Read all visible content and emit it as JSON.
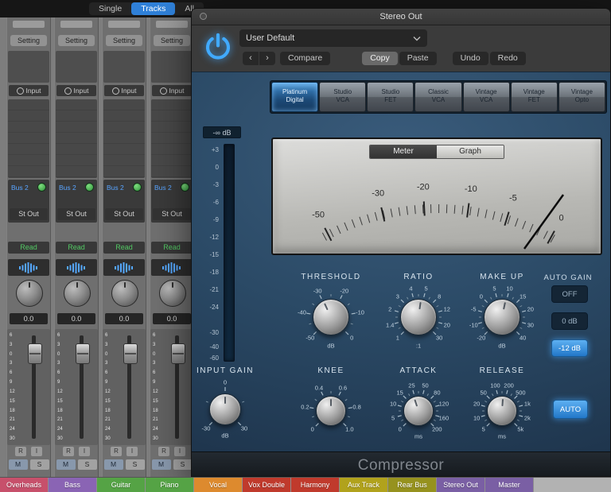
{
  "top_bar": {
    "tabs": [
      {
        "label": "Single",
        "selected": false
      },
      {
        "label": "Tracks",
        "selected": true
      },
      {
        "label": "All",
        "selected": false
      }
    ]
  },
  "mixer": {
    "strip_count": 4,
    "channel_strip": {
      "setting": "Setting",
      "input": "Input",
      "send": "Bus 2",
      "output": "St Out",
      "automation": "Read",
      "volume": "0.0",
      "record": "R",
      "input_monitor": "I",
      "mute": "M",
      "solo": "S",
      "fader_scale": [
        "6",
        "3",
        "0",
        "3",
        "6",
        "9",
        "12",
        "15",
        "18",
        "21",
        "24",
        "30"
      ]
    },
    "track_labels": [
      {
        "name": "Overheads",
        "color": "#c7506b"
      },
      {
        "name": "Bass",
        "color": "#8a64b4"
      },
      {
        "name": "Guitar",
        "color": "#55a345"
      },
      {
        "name": "Piano",
        "color": "#55a345"
      },
      {
        "name": "Vocal",
        "color": "#dd8a2e"
      },
      {
        "name": "Vox Double",
        "color": "#c03a2c"
      },
      {
        "name": "Harmony",
        "color": "#c03a2c"
      },
      {
        "name": "Aux Track",
        "color": "#b1a21c"
      },
      {
        "name": "Rear Bus",
        "color": "#96921e"
      },
      {
        "name": "Stereo Out",
        "color": "#7a5fa4"
      },
      {
        "name": "Master",
        "color": "#7a5fa4"
      }
    ]
  },
  "plugin": {
    "window_title": "Stereo Out",
    "preset_name": "User Default",
    "nav_back": "‹",
    "nav_forward": "›",
    "header_buttons": [
      {
        "label": "Compare",
        "active": false
      },
      {
        "label": "Copy",
        "active": true
      },
      {
        "label": "Paste",
        "active": false
      },
      {
        "label": "Undo",
        "active": false
      },
      {
        "label": "Redo",
        "active": false
      }
    ],
    "circuit_types": [
      {
        "line1": "Platinum",
        "line2": "Digital",
        "selected": true
      },
      {
        "line1": "Studio",
        "line2": "VCA",
        "selected": false
      },
      {
        "line1": "Studio",
        "line2": "FET",
        "selected": false
      },
      {
        "line1": "Classic",
        "line2": "VCA",
        "selected": false
      },
      {
        "line1": "Vintage",
        "line2": "VCA",
        "selected": false
      },
      {
        "line1": "Vintage",
        "line2": "FET",
        "selected": false
      },
      {
        "line1": "Vintage",
        "line2": "Opto",
        "selected": false
      }
    ],
    "gain_meter": {
      "readout": "-∞ dB",
      "scale": [
        "+3",
        "0",
        "-3",
        "-6",
        "-9",
        "-12",
        "-15",
        "-18",
        "-21",
        "-24",
        "-30",
        "-40",
        "-60"
      ]
    },
    "display": {
      "tabs": [
        {
          "label": "Meter",
          "selected": true
        },
        {
          "label": "Graph",
          "selected": false
        }
      ],
      "vu_scale": [
        "-50",
        "-30",
        "-20",
        "-10",
        "-5",
        "0"
      ]
    },
    "knobs": [
      {
        "id": "threshold",
        "label": "THRESHOLD",
        "scale": [
          "-50",
          "-40",
          "-30",
          "-20",
          "-10",
          "0"
        ],
        "unit": "dB"
      },
      {
        "id": "ratio",
        "label": "RATIO",
        "scale": [
          "1",
          "1.4",
          "2",
          "3",
          "4",
          "5",
          "8",
          "12",
          "20",
          "30"
        ],
        "unit": ":1"
      },
      {
        "id": "makeup",
        "label": "MAKE UP",
        "scale": [
          "-20",
          "-10",
          "-5",
          "0",
          "5",
          "10",
          "15",
          "20",
          "30",
          "40"
        ],
        "unit": "dB"
      },
      {
        "id": "input_gain",
        "label": "INPUT GAIN",
        "scale": [
          "-30",
          "0",
          "30"
        ],
        "unit": "dB"
      },
      {
        "id": "knee",
        "label": "KNEE",
        "scale": [
          "0",
          "0.2",
          "0.4",
          "0.6",
          "0.8",
          "1.0"
        ],
        "unit": ""
      },
      {
        "id": "attack",
        "label": "ATTACK",
        "scale": [
          "0",
          "5",
          "10",
          "15",
          "25",
          "50",
          "80",
          "120",
          "160",
          "200"
        ],
        "unit": "ms"
      },
      {
        "id": "release",
        "label": "RELEASE",
        "scale": [
          "5",
          "10",
          "20",
          "50",
          "100",
          "200",
          "500",
          "1k",
          "2k",
          "5k"
        ],
        "unit": "ms"
      }
    ],
    "auto_gain": {
      "label": "AUTO GAIN",
      "options": [
        {
          "label": "OFF",
          "selected": false
        },
        {
          "label": "0 dB",
          "selected": false
        },
        {
          "label": "-12 dB",
          "selected": true
        }
      ]
    },
    "auto_release": {
      "label": "AUTO",
      "selected": true
    },
    "footer": {
      "name": "Compressor"
    }
  },
  "colors": {
    "accent_blue": "#2f80d8",
    "selected_tab_blue": "#2f6da6"
  }
}
